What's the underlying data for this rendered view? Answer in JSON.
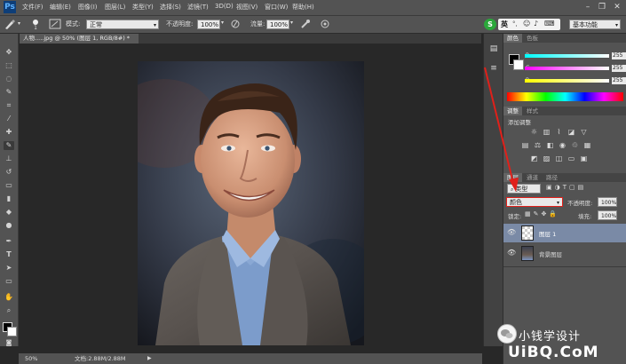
{
  "menubar": {
    "logo": "Ps",
    "items": [
      "文件(F)",
      "编辑(E)",
      "图像(I)",
      "图层(L)",
      "类型(Y)",
      "选择(S)",
      "滤镜(T)",
      "3D(D)",
      "视图(V)",
      "窗口(W)",
      "帮助(H)"
    ],
    "minimize": "–",
    "restore": "❐",
    "close": "✕"
  },
  "options": {
    "brush_size": "1",
    "mode_label": "模式:",
    "mode_value": "正常",
    "opacity_label": "不透明度:",
    "opacity_value": "100%",
    "flow_label": "流量:",
    "flow_value": "100%",
    "input_indicator": "S",
    "input_lang": "英",
    "workspace": "基本功能"
  },
  "document_tab": "人物.....jpg @ 50% (图层 1, RGB/8#) *",
  "status": {
    "zoom": "50%",
    "doc": "文档:2.88M/2.88M"
  },
  "color_panel": {
    "tabs": [
      "颜色",
      "色板"
    ],
    "channels": [
      {
        "name": "R",
        "value": "255"
      },
      {
        "name": "G",
        "value": "255"
      },
      {
        "name": "B",
        "value": "255"
      }
    ]
  },
  "adjustments_panel": {
    "tabs": [
      "调整",
      "样式"
    ],
    "title": "添加调整"
  },
  "layers_panel": {
    "tabs": [
      "图层",
      "通道",
      "路径"
    ],
    "kind_label": "类型",
    "blend_mode": "颜色",
    "opacity_label": "不透明度:",
    "opacity_value": "100%",
    "lock_label": "锁定:",
    "fill_label": "填充:",
    "fill_value": "100%",
    "layers": [
      {
        "name": "图层 1",
        "selected": true
      },
      {
        "name": "背景图层",
        "selected": false
      }
    ]
  },
  "watermark": {
    "text": "小钱学设计",
    "site": "UiBQ.CoM"
  },
  "colors": {
    "annotation_red": "#e0201a",
    "ui_gray": "#535353",
    "canvas_bg": "#282828"
  }
}
